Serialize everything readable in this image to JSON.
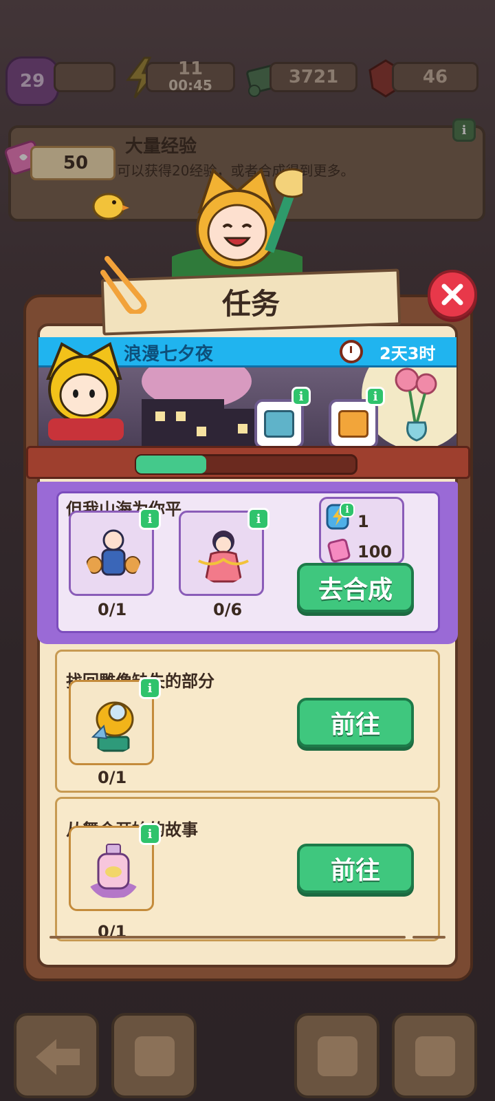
{
  "hud": {
    "level": "29",
    "energy": "11",
    "energy_timer": "00:45",
    "cash": "3721",
    "gems": "46"
  },
  "background_card": {
    "title": "大量经验",
    "description": "可以获得20经验，或者合成得到更多。",
    "tickets": "50"
  },
  "panel": {
    "title": "任务",
    "close_icon": "close-icon"
  },
  "event": {
    "name": "浪漫七夕夜",
    "time_left": "2天3时",
    "progress_fraction": 0.32,
    "info_label": "i"
  },
  "featured_task": {
    "title": "但我山海为你平",
    "items": [
      {
        "count": "0/1"
      },
      {
        "count": "0/6"
      }
    ],
    "rewards": [
      {
        "icon": "energy-battery-icon",
        "amount": "1"
      },
      {
        "icon": "pink-ticket-icon",
        "amount": "100"
      }
    ],
    "button": "去合成"
  },
  "tasks": [
    {
      "title": "找回雕像缺失的部分",
      "count": "0/1",
      "button": "前往"
    },
    {
      "title": "从舞会开始的故事",
      "count": "0/1",
      "button": "前往"
    }
  ],
  "colors": {
    "accent_green": "#3fc77e",
    "close_red": "#e8384a",
    "event_blue": "#20b4ef",
    "featured_purple": "#9a6ad6"
  }
}
